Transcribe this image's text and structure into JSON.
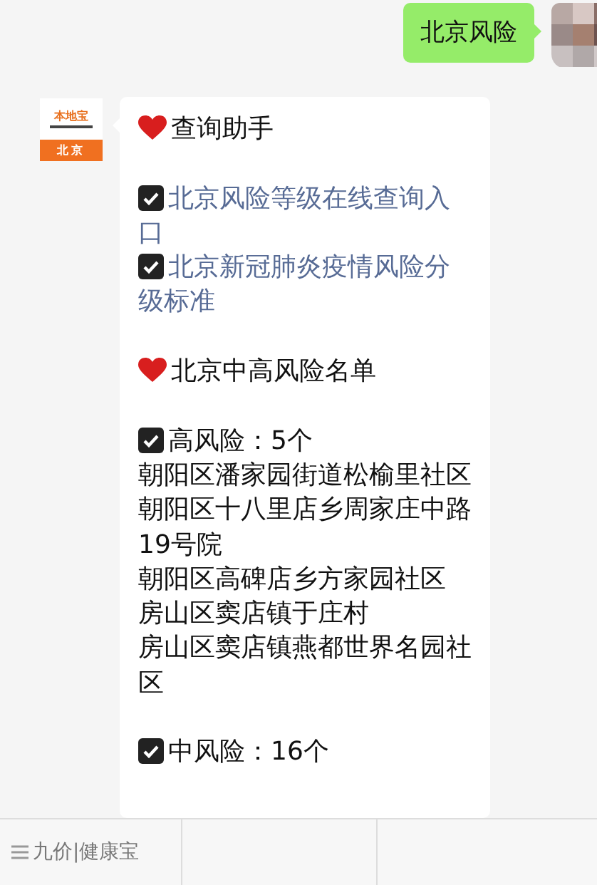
{
  "user_message": {
    "text": "北京风险"
  },
  "bot_avatar": {
    "brand": "本地宝",
    "city": "北京"
  },
  "bot_message": {
    "paragraphs": [
      [
        {
          "kind": "heading",
          "text": "查询助手"
        }
      ],
      [
        {
          "kind": "link",
          "text": "北京风险等级在线查询入口"
        },
        {
          "kind": "link",
          "text": "北京新冠肺炎疫情风险分级标准"
        }
      ],
      [
        {
          "kind": "heading",
          "text": "北京中高风险名单"
        }
      ],
      [
        {
          "kind": "check",
          "text": "高风险：5个"
        },
        {
          "kind": "line",
          "text": "朝阳区潘家园街道松榆里社区"
        },
        {
          "kind": "line",
          "text": "朝阳区十八里店乡周家庄中路19号院"
        },
        {
          "kind": "line",
          "text": "朝阳区高碑店乡方家园社区"
        },
        {
          "kind": "line",
          "text": "房山区窦店镇于庄村"
        },
        {
          "kind": "line",
          "text": "房山区窦店镇燕都世界名园社区"
        }
      ],
      [
        {
          "kind": "check",
          "text": "中风险：16个"
        }
      ]
    ]
  },
  "menu_bar": {
    "items": [
      {
        "label": "九价|健康宝"
      }
    ]
  }
}
